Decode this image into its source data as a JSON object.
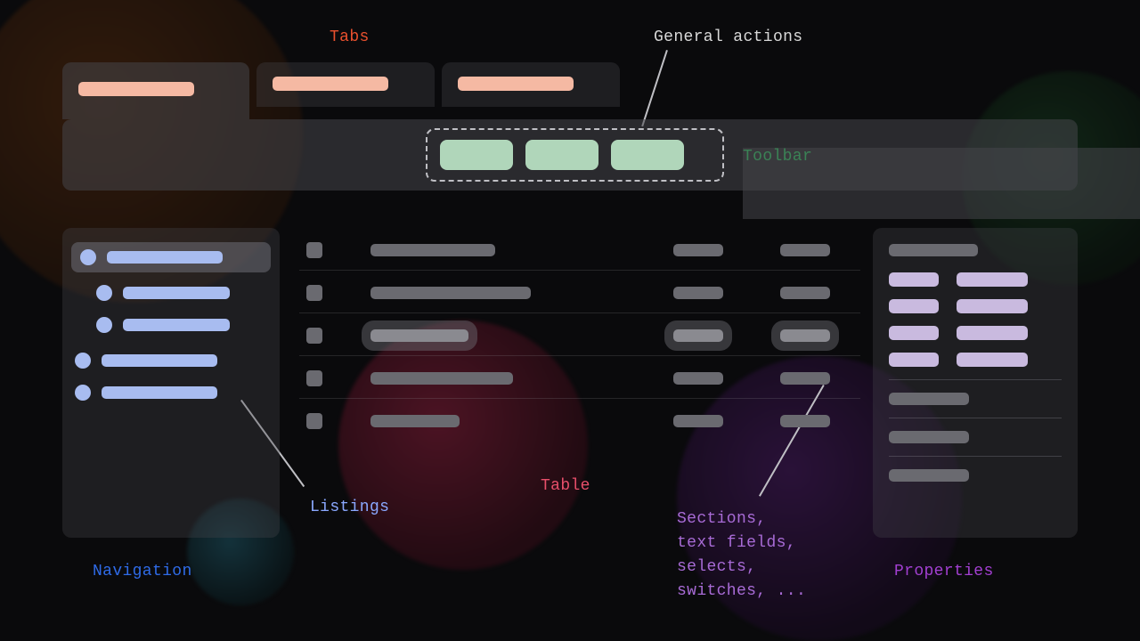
{
  "annotations": {
    "tabs": "Tabs",
    "general_actions": "General actions",
    "toolbar": "Toolbar",
    "listings": "Listings",
    "navigation": "Navigation",
    "table": "Table",
    "sections": "Sections,\ntext fields,\nselects,\nswitches, ...",
    "properties": "Properties"
  },
  "colors": {
    "tabs": "#e8502e",
    "toolbar": "#2ecc62",
    "navigation": "#2f6be8",
    "listings": "#8aa8ff",
    "table": "#e84f6a",
    "properties": "#a23fd1",
    "sections": "#a86bd6",
    "neutral_text": "#d8d8d8"
  },
  "layout": {
    "tab_count": 3,
    "toolbar_actions": 3,
    "navigation_items": 5,
    "navigation_nested_indices": [
      1,
      2
    ],
    "navigation_selected_index": 0,
    "table_rows": 5,
    "table_columns": 3,
    "table_selected_row_index": 2,
    "properties_pairs": 4,
    "properties_extra_lines": 3
  }
}
